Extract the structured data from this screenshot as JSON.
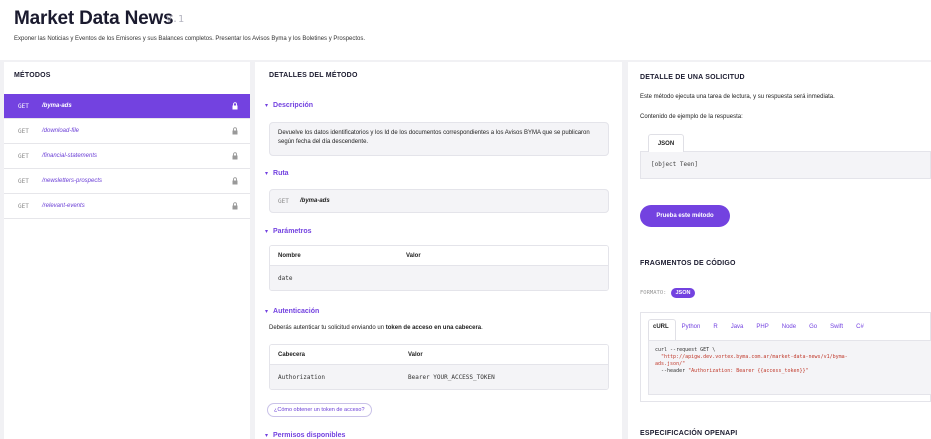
{
  "header": {
    "title": "Market Data News",
    "version": "V.1",
    "subtitle": "Exponer las Noticias y Eventos de los Emisores y sus Balances completos. Presentar los Avisos Byma y los Boletines y Prospectos."
  },
  "methods": {
    "heading": "MÉTODOS",
    "items": [
      {
        "verb": "GET",
        "name": "/byma-ads",
        "active": true
      },
      {
        "verb": "GET",
        "name": "/download-file",
        "active": false
      },
      {
        "verb": "GET",
        "name": "/financial-statements",
        "active": false
      },
      {
        "verb": "GET",
        "name": "/newsletters-prospects",
        "active": false
      },
      {
        "verb": "GET",
        "name": "/relevant-events",
        "active": false
      }
    ]
  },
  "details": {
    "heading": "DETALLES DEL MÉTODO",
    "description_label": "Descripción",
    "description_text": "Devuelve los datos identificatorios y los Id de los documentos correspondientes a los Avisos BYMA que se publicaron según fecha del día descendente.",
    "route_label": "Ruta",
    "route_verb": "GET",
    "route_path": "/byma-ads",
    "params_label": "Parámetros",
    "params_columns": [
      "Nombre",
      "Valor"
    ],
    "params_rows": [
      [
        "date",
        ""
      ]
    ],
    "auth_label": "Autenticación",
    "auth_text_pre": "Deberás autenticar tu solicitud enviando un ",
    "auth_text_bold": "token de acceso en una cabecera",
    "auth_text_post": ".",
    "auth_columns": [
      "Cabecera",
      "Valor"
    ],
    "auth_rows": [
      [
        "Authorization",
        "Bearer YOUR_ACCESS_TOKEN"
      ]
    ],
    "token_link": "¿Cómo obtener un token de acceso?",
    "permissions_label": "Permisos disponibles"
  },
  "request": {
    "heading": "DETALLE DE UNA SOLICITUD",
    "info": "Este método ejecuta una tarea de lectura, y su respuesta será inmediata.",
    "example_label": "Contenido de ejemplo de la respuesta:",
    "tab": "JSON",
    "response": "[object Teen]",
    "try_button": "Prueba este método"
  },
  "snippets": {
    "heading": "FRAGMENTOS DE CÓDIGO",
    "format_label": "FORMATO:",
    "format_value": "JSON",
    "langs": [
      "cURL",
      "Python",
      "R",
      "Java",
      "PHP",
      "Node",
      "Go",
      "Swift",
      "C#"
    ],
    "active_lang": "cURL",
    "code_line1": "curl --request GET \\",
    "code_line2": "  \"http://apigw.dev.vortex.byma.com.ar/market-data-news/v1/byma-",
    "code_line3": "ads.json/\"",
    "code_line4_pre": "  --header ",
    "code_line4_str": "\"Authorization: Bearer {{access_token}}\""
  },
  "openapi": {
    "heading": "ESPECIFICACIÓN OPENAPI"
  },
  "colors": {
    "accent": "#7342e0",
    "background": "#f1f1f4"
  }
}
